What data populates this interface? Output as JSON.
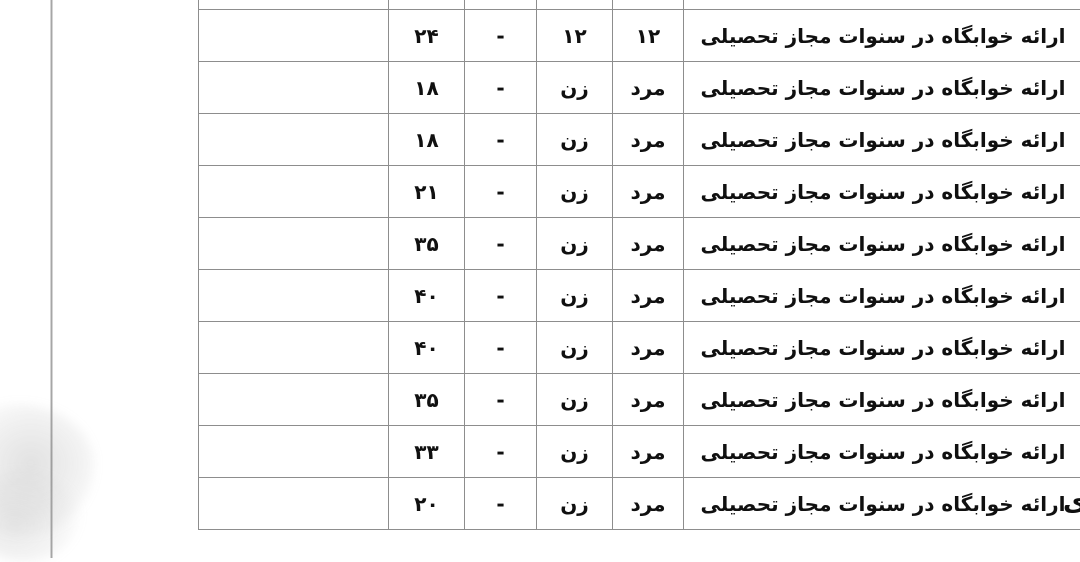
{
  "document": {
    "language": "fa",
    "direction": "rtl",
    "background_color": "#ffffff",
    "table_border_color": "#8d8d8d",
    "text_color": "#101010"
  },
  "table": {
    "column_count": 6,
    "columns": [
      {
        "key": "description",
        "label": ""
      },
      {
        "key": "col_a",
        "label": ""
      },
      {
        "key": "col_b",
        "label": ""
      },
      {
        "key": "col_c",
        "label": ""
      },
      {
        "key": "col_d",
        "label": ""
      },
      {
        "key": "col_e",
        "label": ""
      }
    ],
    "clipped_top_row": {
      "note": "row cut off by top edge of screenshot; only descenders of Persian text visible",
      "description": "",
      "col_a": "",
      "col_b": "",
      "col_c": "",
      "col_d": "",
      "col_e": ""
    },
    "rows": [
      {
        "description": "ارائه خوابگاه در سنوات مجاز تحصیلی",
        "col_a": "۱۲",
        "col_b": "۱۲",
        "col_c": "-",
        "col_d": "۲۴",
        "col_e": ""
      },
      {
        "description": "ارائه خوابگاه در سنوات مجاز تحصیلی",
        "col_a": "مرد",
        "col_b": "زن",
        "col_c": "-",
        "col_d": "۱۸",
        "col_e": ""
      },
      {
        "description": "ارائه خوابگاه در سنوات مجاز تحصیلی",
        "col_a": "مرد",
        "col_b": "زن",
        "col_c": "-",
        "col_d": "۱۸",
        "col_e": ""
      },
      {
        "description": "ارائه خوابگاه در سنوات مجاز تحصیلی",
        "col_a": "مرد",
        "col_b": "زن",
        "col_c": "-",
        "col_d": "۲۱",
        "col_e": ""
      },
      {
        "description": "ارائه خوابگاه در سنوات مجاز تحصیلی",
        "col_a": "مرد",
        "col_b": "زن",
        "col_c": "-",
        "col_d": "۳۵",
        "col_e": ""
      },
      {
        "description": "ارائه خوابگاه در سنوات مجاز تحصیلی",
        "col_a": "مرد",
        "col_b": "زن",
        "col_c": "-",
        "col_d": "۴۰",
        "col_e": ""
      },
      {
        "description": "ارائه خوابگاه در سنوات مجاز تحصیلی",
        "col_a": "مرد",
        "col_b": "زن",
        "col_c": "-",
        "col_d": "۴۰",
        "col_e": ""
      },
      {
        "description": "ارائه خوابگاه در سنوات مجاز تحصیلی",
        "col_a": "مرد",
        "col_b": "زن",
        "col_c": "-",
        "col_d": "۳۵",
        "col_e": ""
      },
      {
        "description": "ارائه خوابگاه در سنوات مجاز تحصیلی",
        "col_a": "مرد",
        "col_b": "زن",
        "col_c": "-",
        "col_d": "۳۳",
        "col_e": ""
      },
      {
        "description": "ارائه خوابگاه در سنوات مجاز تحصیلی",
        "col_a": "مرد",
        "col_b": "زن",
        "col_c": "-",
        "col_d": "۲۰",
        "col_e": ""
      }
    ]
  },
  "edge_fragments": {
    "right_bottom_glyph": "ی",
    "right_middle_faint_glyph": "ی"
  }
}
